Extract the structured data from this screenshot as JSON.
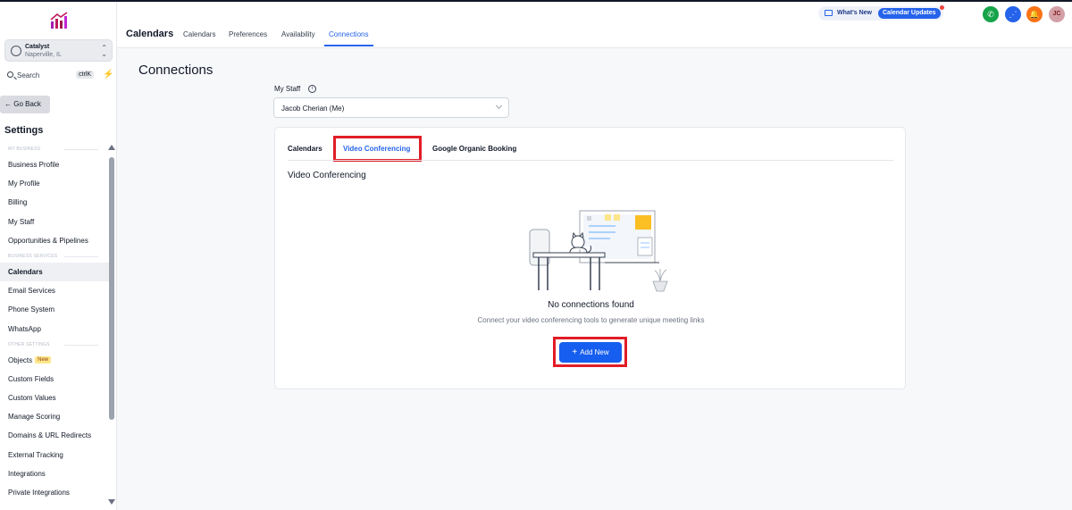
{
  "account": {
    "name": "Catalyst",
    "location": "Naperville, IL"
  },
  "search": {
    "label": "Search",
    "shortcut": "ctrlK"
  },
  "sidebar": {
    "go_back": "Go Back",
    "title": "Settings",
    "sections": [
      {
        "label": "MY BUSINESS",
        "items": [
          "Business Profile",
          "My Profile",
          "Billing",
          "My Staff",
          "Opportunities & Pipelines"
        ]
      },
      {
        "label": "BUSINESS SERVICES",
        "items": [
          "Calendars",
          "Email Services",
          "Phone System",
          "WhatsApp"
        ]
      },
      {
        "label": "OTHER SETTINGS",
        "items": [
          "Objects",
          "Custom Fields",
          "Custom Values",
          "Manage Scoring",
          "Domains & URL Redirects",
          "External Tracking",
          "Integrations",
          "Private Integrations"
        ]
      }
    ],
    "active_item": "Calendars",
    "new_badge": "New"
  },
  "header": {
    "title": "Calendars",
    "tabs": [
      "Calendars",
      "Preferences",
      "Availability",
      "Connections"
    ],
    "active_tab": "Connections",
    "whats_new": "What's New",
    "whats_new_badge": "Calendar Updates",
    "avatar_initials": "JC"
  },
  "main": {
    "page_title": "Connections",
    "staff_label": "My Staff",
    "staff_value": "Jacob Cherian (Me)",
    "card_tabs": [
      "Calendars",
      "Video Conferencing",
      "Google Organic Booking"
    ],
    "active_card_tab": "Video Conferencing",
    "section_title": "Video Conferencing",
    "empty_title": "No connections found",
    "empty_subtitle": "Connect your video conferencing tools to generate unique meeting links",
    "add_button": "Add New"
  },
  "colors": {
    "accent": "#2563eb",
    "highlight": "#e11d26",
    "button": "#155eef"
  },
  "icons": [
    "logo-icon",
    "location-icon",
    "chevron-updown-icon",
    "search-icon",
    "bolt-icon",
    "arrow-left-icon",
    "info-icon",
    "chevron-down-icon",
    "megaphone-icon",
    "phone-icon",
    "dialpad-icon",
    "bell-icon",
    "plus-icon"
  ]
}
